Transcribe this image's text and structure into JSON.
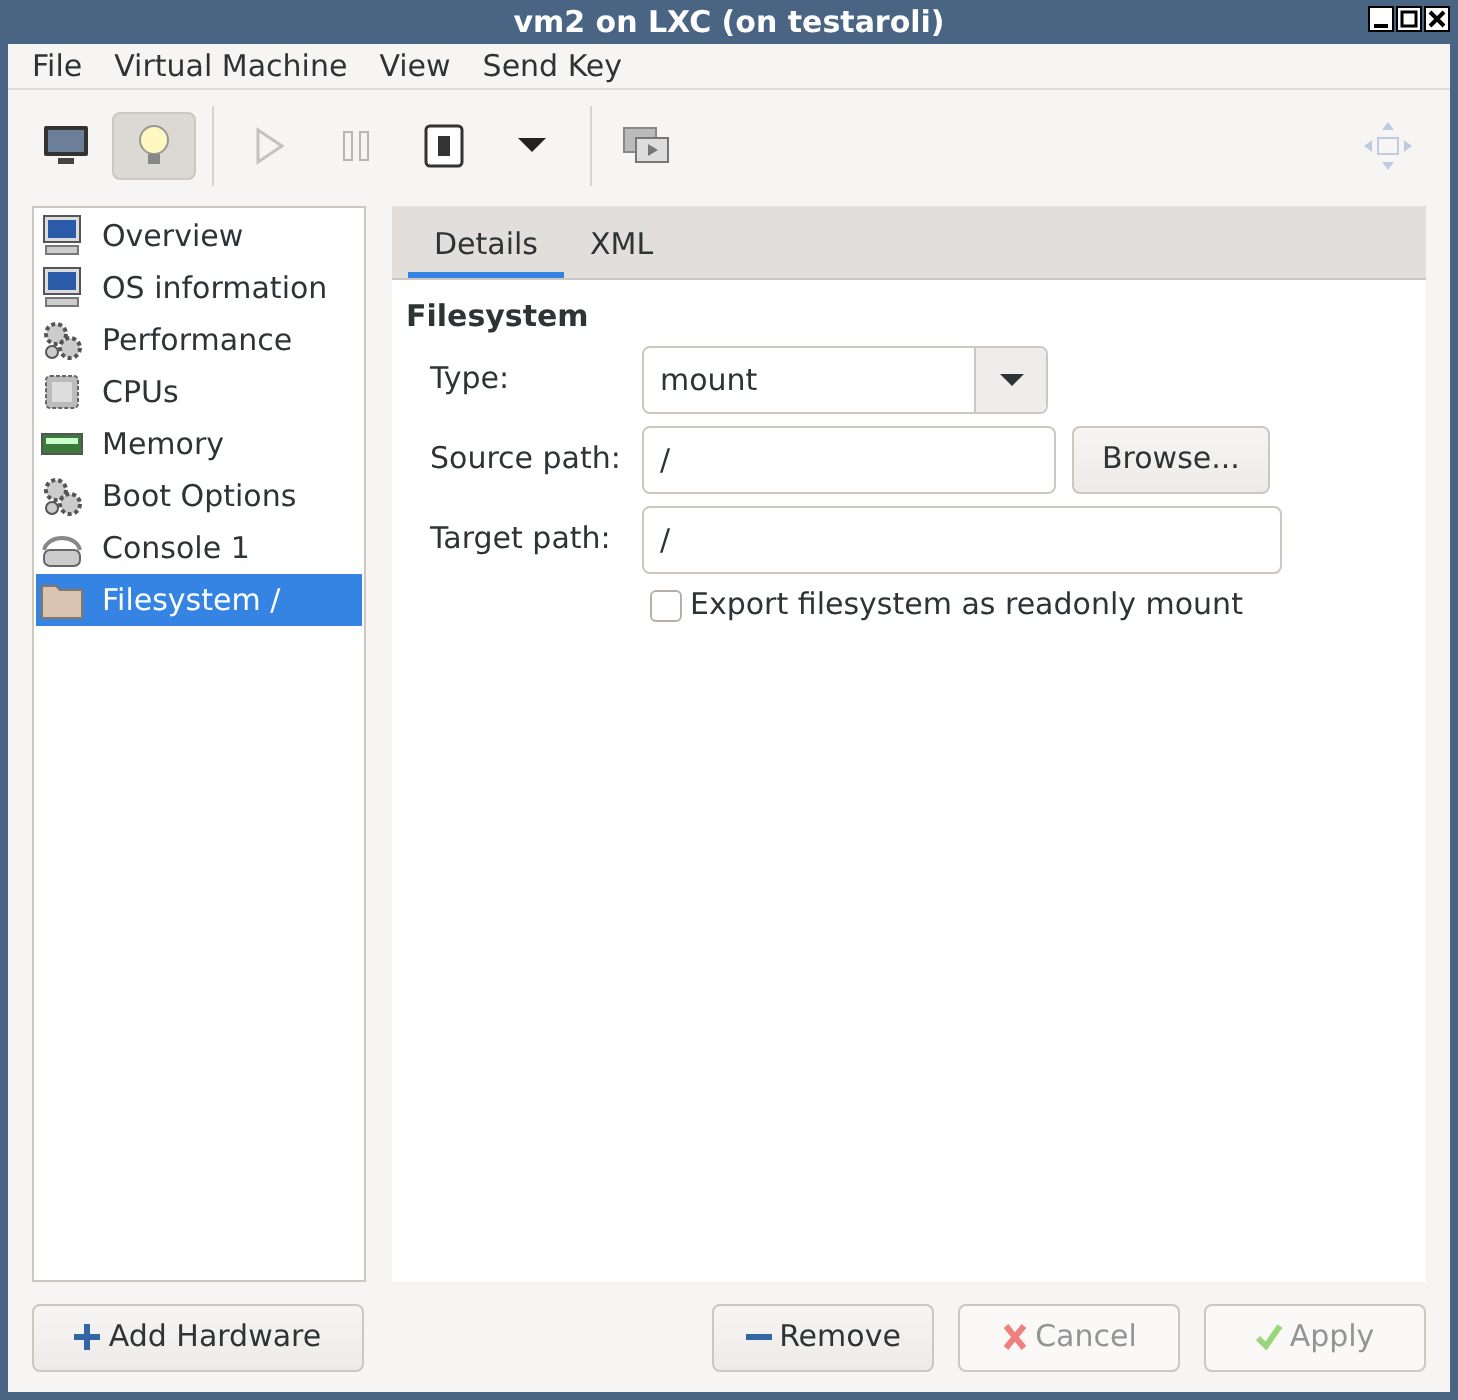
{
  "window": {
    "title": "vm2 on LXC (on testaroli)"
  },
  "menu": [
    "File",
    "Virtual Machine",
    "View",
    "Send Key"
  ],
  "toolbar": [
    {
      "kind": "console",
      "selected": false,
      "disabled": false
    },
    {
      "kind": "details",
      "selected": true,
      "disabled": false
    },
    {
      "kind": "sep"
    },
    {
      "kind": "run",
      "selected": false,
      "disabled": true
    },
    {
      "kind": "pause",
      "selected": false,
      "disabled": true
    },
    {
      "kind": "power",
      "selected": false,
      "disabled": false
    },
    {
      "kind": "caret",
      "selected": false,
      "disabled": false
    },
    {
      "kind": "sep"
    },
    {
      "kind": "snapshots",
      "selected": false,
      "disabled": false
    },
    {
      "kind": "spacer"
    },
    {
      "kind": "fullscreen",
      "selected": false,
      "disabled": true
    }
  ],
  "sidebar": {
    "items": [
      {
        "label": "Overview",
        "kind": "monitor",
        "selected": false
      },
      {
        "label": "OS information",
        "kind": "monitor",
        "selected": false
      },
      {
        "label": "Performance",
        "kind": "gears",
        "selected": false
      },
      {
        "label": "CPUs",
        "kind": "chip",
        "selected": false
      },
      {
        "label": "Memory",
        "kind": "ram",
        "selected": false
      },
      {
        "label": "Boot Options",
        "kind": "gears",
        "selected": false
      },
      {
        "label": "Console 1",
        "kind": "serial",
        "selected": false
      },
      {
        "label": "Filesystem /",
        "kind": "folder",
        "selected": true
      }
    ]
  },
  "tabs": [
    {
      "label": "Details",
      "selected": true
    },
    {
      "label": "XML",
      "selected": false
    }
  ],
  "section": "Filesystem",
  "form": {
    "type": {
      "label": "Type:",
      "value": "mount"
    },
    "source": {
      "label": "Source path:",
      "value": "/",
      "button": "Browse..."
    },
    "target": {
      "label": "Target path:",
      "value": "/"
    },
    "readonly": {
      "label": "Export filesystem as readonly mount",
      "checked": false
    }
  },
  "buttons": [
    {
      "label": "Add Hardware",
      "kind": "add",
      "disabled": false
    },
    {
      "label": "Remove",
      "kind": "remove",
      "disabled": false
    },
    {
      "label": "Cancel",
      "kind": "cancel",
      "disabled": true
    },
    {
      "label": "Apply",
      "kind": "apply",
      "disabled": true
    }
  ]
}
